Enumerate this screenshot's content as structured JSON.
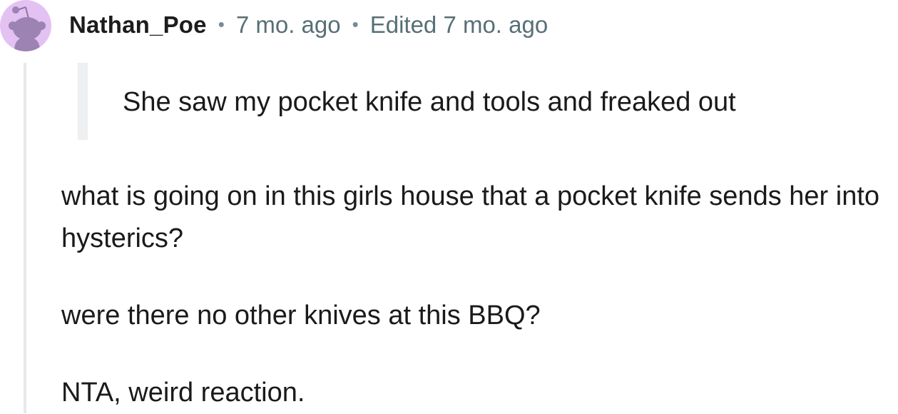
{
  "comment": {
    "username": "Nathan_Poe",
    "separator": "•",
    "posted_time": "7 mo. ago",
    "edited_label": "Edited 7 mo. ago",
    "avatar_icon": "snoo-avatar-icon",
    "quote": "She saw my pocket knife and tools and freaked out",
    "paragraphs": [
      "what is going on in this girls house that a pocket knife sends her into hysterics?",
      "were there no other knives at this BBQ?",
      "NTA, weird reaction."
    ]
  },
  "colors": {
    "avatar_bg": "#e3c1f3",
    "avatar_figure": "#9c83b3",
    "meta_text": "#576f76",
    "thread_line": "#e6e8ea",
    "quote_bar": "#eeeff0"
  }
}
